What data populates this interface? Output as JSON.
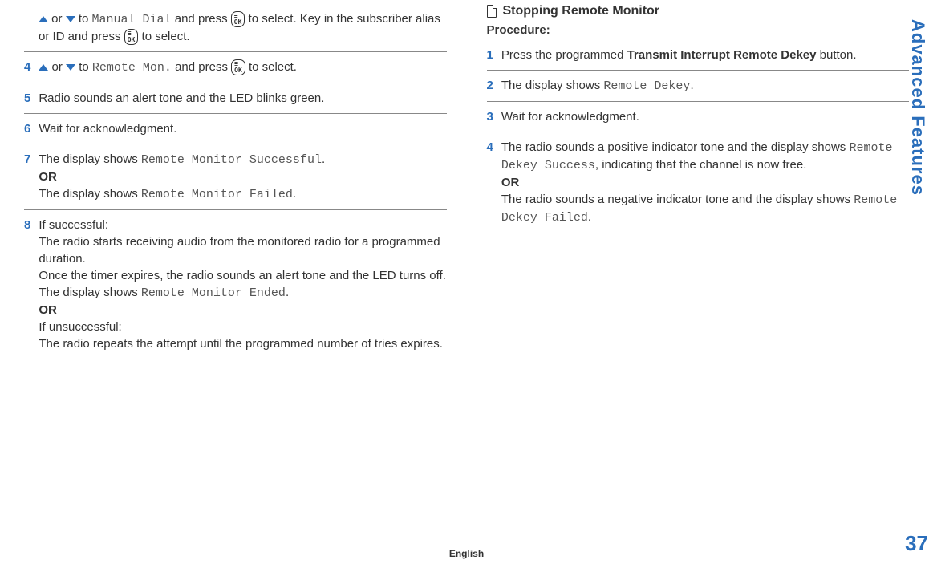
{
  "sidebar_title": "Advanced Features",
  "page_number": "37",
  "language": "English",
  "left": {
    "continuation": {
      "p0a": " or ",
      "p0b": " to ",
      "manual_dial": "Manual Dial",
      "p0c": " and press ",
      "p0d": " to select. Key in the subscriber alias or ID and press ",
      "p0e": " to select."
    },
    "step4": {
      "num": "4",
      "a": " or ",
      "b": " to ",
      "remote_mon": "Remote Mon.",
      "c": " and press ",
      "d": " to select."
    },
    "step5": {
      "num": "5",
      "text": "Radio sounds an alert tone and the LED blinks green."
    },
    "step6": {
      "num": "6",
      "text": "Wait for acknowledgment."
    },
    "step7": {
      "num": "7",
      "a": "The display shows ",
      "rm_success": "Remote Monitor Successful",
      "b": ".",
      "or": "OR",
      "c": "The display shows ",
      "rm_failed": "Remote Monitor Failed",
      "d": "."
    },
    "step8": {
      "num": "8",
      "a": "If successful:",
      "b": "The radio starts receiving audio from the monitored radio for a programmed duration.",
      "c": "Once the timer expires, the radio sounds an alert tone and the LED turns off. The display shows ",
      "rm_ended": "Remote Monitor Ended",
      "d": ".",
      "or": "OR",
      "e": "If unsuccessful:",
      "f": "The radio repeats the attempt until the programmed number of tries expires."
    }
  },
  "right": {
    "heading": "Stopping Remote Monitor",
    "procedure_label": "Procedure:",
    "step1": {
      "num": "1",
      "a": "Press the programmed ",
      "btn": "Transmit Interrupt Remote Dekey",
      "b": " button."
    },
    "step2": {
      "num": "2",
      "a": "The display shows ",
      "rd": "Remote Dekey",
      "b": "."
    },
    "step3": {
      "num": "3",
      "text": "Wait for acknowledgment."
    },
    "step4": {
      "num": "4",
      "a": "The radio sounds a positive indicator tone and the display shows ",
      "rds": "Remote Dekey Success",
      "b": ", indicating that the channel is now free.",
      "or": "OR",
      "c": "The radio sounds a negative indicator tone and the display shows ",
      "rdf": "Remote Dekey Failed",
      "d": "."
    }
  }
}
